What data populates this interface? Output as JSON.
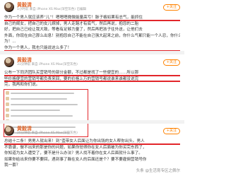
{
  "posts": [
    {
      "username": "黄毅清",
      "meta": "1小时前  来自 iPhone XS Max(深空灰色)  已编辑",
      "follow_label": "+关注",
      "lines": [
        "作为一个男人就应该养“儿”！嗯嗯嗯微微能量高亏！脉子格如果有志气，能抓住",
        "自己的闺女，把自己的女儿嫁掉，男人走路才有底气，然后再说，抱怨的二胎",
        "好，把自己已经让我大致，等看有足够力量了，然后再把孩子往外送，让他们去",
        "外面，你现在自己那么出息！别抱怨自己不能在自己强大起来之前，你什么气都只能一个人忍，你什么",
        "为！...",
        "作为一个男人，我也只能说这么多了！"
      ]
    },
    {
      "username": "黄毅清",
      "meta": "31分钟前  来自 iPhone XS Max(深空灰色)",
      "follow_label": "+关注",
      "lines": [
        "公布一下同济团队买营销号的部分金额，不过都是找了一些便宜的……所以那",
        "些价格便宜的营销号都负责来回，要的价格上万的营销号都说谁来谁都没说完",
        "完，我再和你们说。"
      ]
    },
    {
      "username": "黄毅清",
      "meta": "20分钟前  来自 iPhone XS Max(深空灰色)",
      "follow_label": "+关注",
      "lines": [
        "总结十二条！男男人就出来！到“歪带女人后面让为你出钱的女人帮你出头。男人",
        "不靠谱，做不出来的那是你的问题，如果你觉得你在女人后面被为你买完东西了，",
        "你知道为女人遭受了，要不是什么办法？男人找不着你在女人后面就什么事了。",
        "如果你给出来你要不要回，遇到事了躲在女人的后面还是个？要不要雇佣营销号你",
        "我一套？"
      ]
    }
  ],
  "watermark": "头条 @生活育专区之佩尔"
}
